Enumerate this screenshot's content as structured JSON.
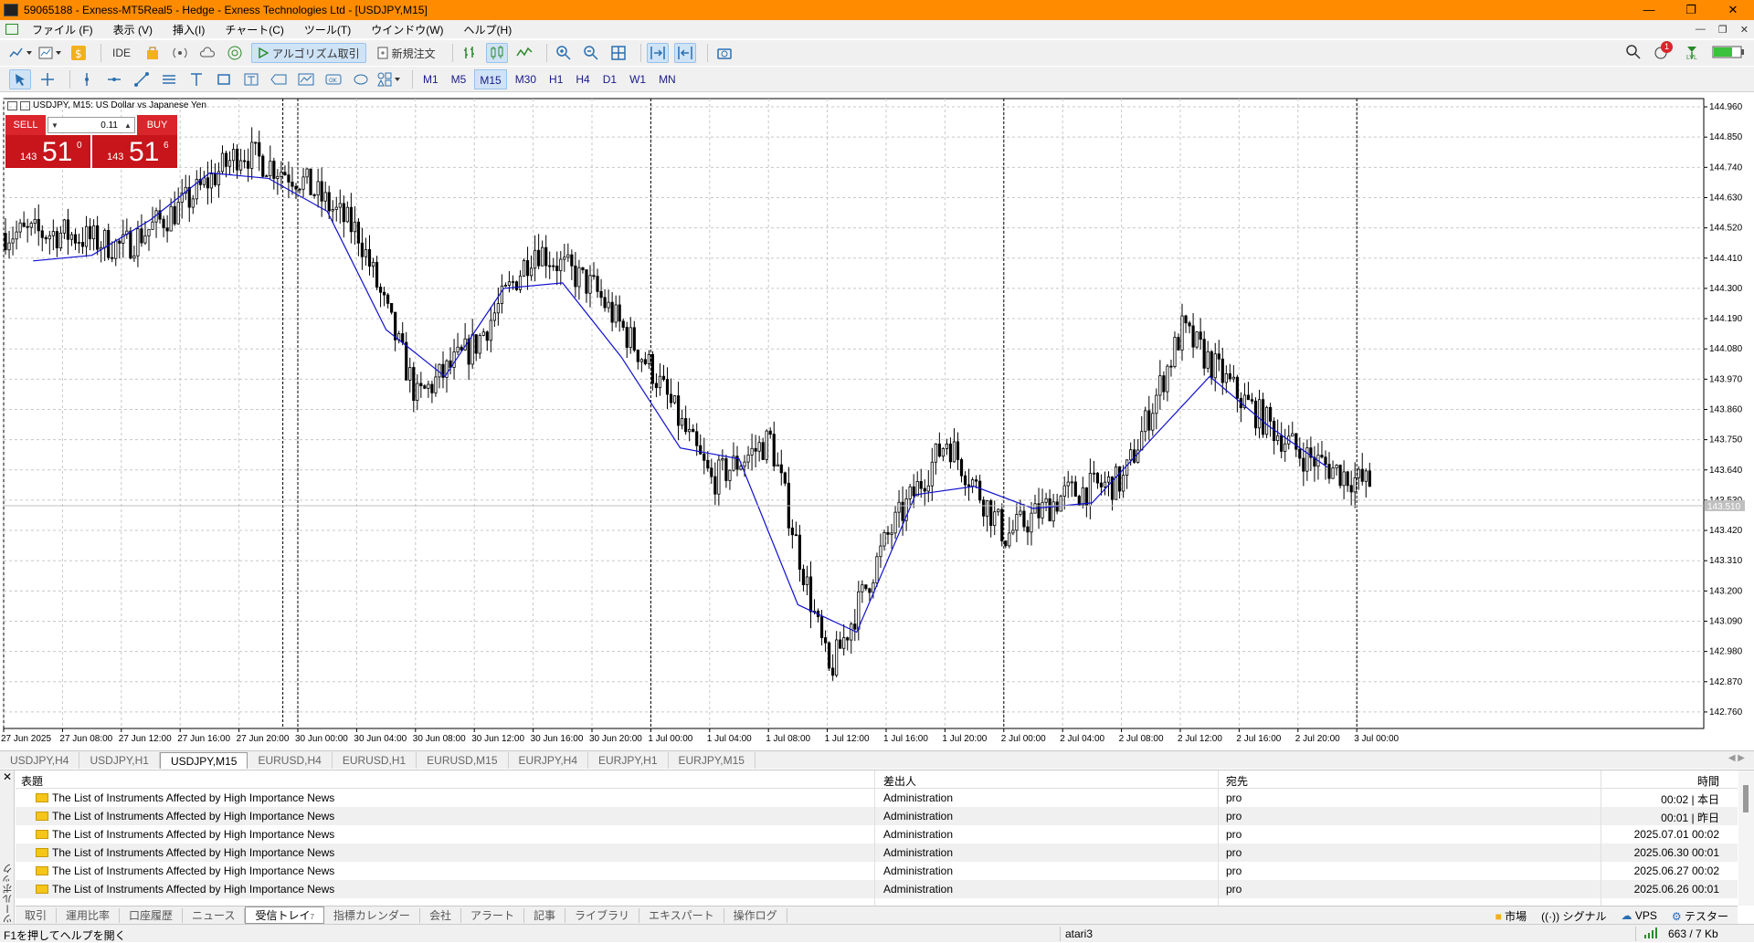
{
  "window": {
    "title": "59065188 - Exness-MT5Real5 - Hedge - Exness Technologies Ltd - [USDJPY,M15]"
  },
  "menu": [
    "ファイル (F)",
    "表示 (V)",
    "挿入(I)",
    "チャート(C)",
    "ツール(T)",
    "ウインドウ(W)",
    "ヘルプ(H)"
  ],
  "toolbar": {
    "ide_label": "IDE",
    "algo_label": "アルゴリズム取引",
    "neworder_label": "新規注文",
    "notification_count": "1",
    "lvl_label": "LVL"
  },
  "timeframes": [
    "M1",
    "M5",
    "M15",
    "M30",
    "H1",
    "H4",
    "D1",
    "W1",
    "MN"
  ],
  "active_timeframe": "M15",
  "chart": {
    "header": "USDJPY, M15:  US Dollar vs Japanese Yen",
    "current_price": "143.510",
    "price_labels": [
      "144.960",
      "144.850",
      "144.740",
      "144.630",
      "144.520",
      "144.410",
      "144.300",
      "144.190",
      "144.080",
      "143.970",
      "143.860",
      "143.750",
      "143.640",
      "143.530",
      "143.420",
      "143.310",
      "143.200",
      "143.090",
      "142.980",
      "142.870",
      "142.760"
    ],
    "time_labels": [
      "27 Jun 2025",
      "27 Jun 08:00",
      "27 Jun 12:00",
      "27 Jun 16:00",
      "27 Jun 20:00",
      "30 Jun 00:00",
      "30 Jun 04:00",
      "30 Jun 08:00",
      "30 Jun 12:00",
      "30 Jun 16:00",
      "30 Jun 20:00",
      "1 Jul 00:00",
      "1 Jul 04:00",
      "1 Jul 08:00",
      "1 Jul 12:00",
      "1 Jul 16:00",
      "1 Jul 20:00",
      "2 Jul 00:00",
      "2 Jul 04:00",
      "2 Jul 08:00",
      "2 Jul 12:00",
      "2 Jul 16:00",
      "2 Jul 20:00",
      "3 Jul 00:00"
    ],
    "colors": {
      "candle": "#000000",
      "ma": "#1010d0",
      "grid": "#c8c8c8",
      "sell": "#d9252b",
      "price_line": "#c0c0c0"
    }
  },
  "chart_data": {
    "type": "candlestick",
    "symbol": "USDJPY",
    "timeframe": "M15",
    "ylim": [
      142.7,
      144.99
    ],
    "y_ticks": [
      144.96,
      144.85,
      144.74,
      144.63,
      144.52,
      144.41,
      144.3,
      144.19,
      144.08,
      143.97,
      143.86,
      143.75,
      143.64,
      143.53,
      143.42,
      143.31,
      143.2,
      143.09,
      142.98,
      142.87,
      142.76
    ],
    "current_price": 143.51,
    "x": [
      "27 Jun 2025",
      "27 Jun 08:00",
      "27 Jun 12:00",
      "27 Jun 16:00",
      "27 Jun 20:00",
      "30 Jun 00:00",
      "30 Jun 04:00",
      "30 Jun 08:00",
      "30 Jun 12:00",
      "30 Jun 16:00",
      "30 Jun 20:00",
      "1 Jul 00:00",
      "1 Jul 04:00",
      "1 Jul 08:00",
      "1 Jul 12:00",
      "1 Jul 16:00",
      "1 Jul 20:00",
      "2 Jul 00:00",
      "2 Jul 04:00",
      "2 Jul 08:00",
      "2 Jul 12:00",
      "2 Jul 16:00",
      "2 Jul 20:00",
      "3 Jul 00:00"
    ],
    "close": [
      144.5,
      144.45,
      144.6,
      144.8,
      144.7,
      144.5,
      143.9,
      144.1,
      144.45,
      144.3,
      144.0,
      143.6,
      143.75,
      142.9,
      143.4,
      143.75,
      143.4,
      143.55,
      143.6,
      144.15,
      143.9,
      143.7,
      143.6,
      143.55
    ],
    "ma": [
      144.4,
      144.42,
      144.55,
      144.72,
      144.7,
      144.58,
      144.15,
      143.98,
      144.3,
      144.32,
      144.05,
      143.72,
      143.68,
      143.15,
      143.05,
      143.55,
      143.58,
      143.5,
      143.52,
      143.75,
      143.98,
      143.8,
      143.65,
      143.58
    ]
  },
  "trade_panel": {
    "sell_label": "SELL",
    "buy_label": "BUY",
    "volume": "0.11",
    "bid_prefix": "143",
    "bid_big": "51",
    "bid_sup": "0",
    "ask_prefix": "143",
    "ask_big": "51",
    "ask_sup": "6"
  },
  "chart_tabs": [
    "USDJPY,H4",
    "USDJPY,H1",
    "USDJPY,M15",
    "EURUSD,H4",
    "EURUSD,H1",
    "EURUSD,M15",
    "EURJPY,H4",
    "EURJPY,H1",
    "EURJPY,M15"
  ],
  "active_chart_tab": "USDJPY,M15",
  "toolbox": {
    "side_label": "ツールボックス",
    "columns": {
      "subject": "表題",
      "from": "差出人",
      "to": "宛先",
      "time": "時間"
    },
    "rows": [
      {
        "subject": "The List of Instruments Affected by High Importance News",
        "from": "Administration",
        "to": "pro",
        "time": "00:02 | 本日"
      },
      {
        "subject": "The List of Instruments Affected by High Importance News",
        "from": "Administration",
        "to": "pro",
        "time": "00:01 | 昨日"
      },
      {
        "subject": "The List of Instruments Affected by High Importance News",
        "from": "Administration",
        "to": "pro",
        "time": "2025.07.01 00:02"
      },
      {
        "subject": "The List of Instruments Affected by High Importance News",
        "from": "Administration",
        "to": "pro",
        "time": "2025.06.30 00:01"
      },
      {
        "subject": "The List of Instruments Affected by High Importance News",
        "from": "Administration",
        "to": "pro",
        "time": "2025.06.27 00:02"
      },
      {
        "subject": "The List of Instruments Affected by High Importance News",
        "from": "Administration",
        "to": "pro",
        "time": "2025.06.26 00:01"
      }
    ],
    "tabs": [
      "取引",
      "運用比率",
      "口座履歴",
      "ニュース",
      "受信トレイ",
      "指標カレンダー",
      "会社",
      "アラート",
      "記事",
      "ライブラリ",
      "エキスパート",
      "操作ログ"
    ],
    "active_tab": "受信トレイ",
    "inbox_badge": "7",
    "right": {
      "market": "市場",
      "signals": "シグナル",
      "vps": "VPS",
      "tester": "テスター"
    }
  },
  "status": {
    "help": "F1を押してヘルプを開く",
    "profile": "atari3",
    "traffic": "663 / 7 Kb"
  }
}
